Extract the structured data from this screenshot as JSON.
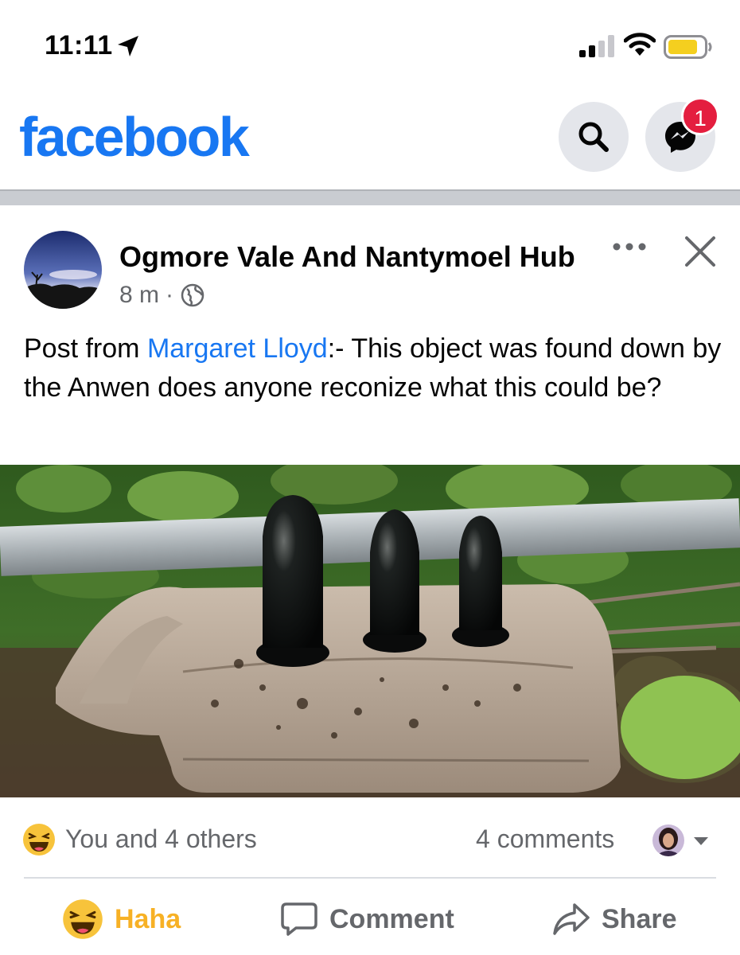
{
  "status_bar": {
    "time": "11:11",
    "icons": [
      "location-arrow-icon",
      "cellular-signal-icon",
      "wifi-icon",
      "battery-icon"
    ]
  },
  "header": {
    "logo": "facebook",
    "brand_color": "#1877f2",
    "search_icon": "search-icon",
    "messenger_icon": "messenger-icon",
    "messenger_badge": "1"
  },
  "post": {
    "author": "Ogmore Vale And Nantymoel Hub",
    "time": "8 m",
    "separator": "·",
    "audience_icon": "globe-icon",
    "text_prefix": "Post from ",
    "mention": "Margaret Lloyd",
    "text_suffix": ":- This object was found down by the Anwen does anyone reconize what this could be?",
    "mention_color": "#1877f2"
  },
  "reactions": {
    "icon": "haha-emoji-icon",
    "summary": "You and 4 others",
    "comments": "4 comments"
  },
  "actions": {
    "haha_label": "Haha",
    "haha_color": "#f7b125",
    "comment_label": "Comment",
    "share_label": "Share"
  }
}
